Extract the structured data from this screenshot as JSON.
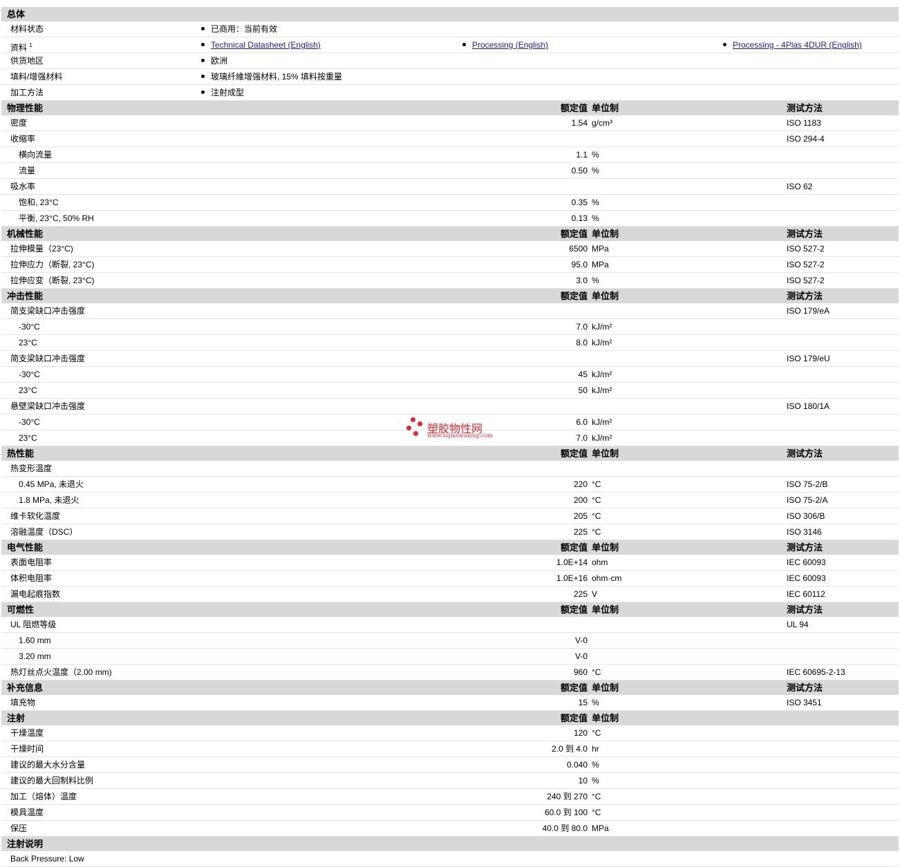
{
  "general": {
    "title": "总体",
    "rows": [
      {
        "label": "材料状态",
        "items": [
          "已商用：当前有效"
        ]
      },
      {
        "label": "资料",
        "sup": "1",
        "links": [
          "Technical Datasheet (English)",
          "Processing (English)",
          "Processing - 4Plas 4DUR (English)"
        ]
      },
      {
        "label": "供货地区",
        "items": [
          "欧洲"
        ]
      },
      {
        "label": "填料/增强材料",
        "items": [
          "玻璃纤維增强材料, 15% 填料按重量"
        ]
      },
      {
        "label": "加工方法",
        "items": [
          "注射成型"
        ]
      }
    ]
  },
  "headers": {
    "nominal": "额定值",
    "unit": "单位制",
    "test": "测试方法"
  },
  "sections": [
    {
      "title": "物理性能",
      "test_header": true,
      "rows": [
        {
          "label": "密度",
          "value": "1.54",
          "unit": "g/cm³",
          "test": "ISO 1183"
        },
        {
          "label": "收缩率",
          "value": "",
          "unit": "",
          "test": "ISO 294-4"
        },
        {
          "label": "横向流量",
          "sub": true,
          "value": "1.1",
          "unit": "%",
          "test": ""
        },
        {
          "label": "流量",
          "sub": true,
          "value": "0.50",
          "unit": "%",
          "test": ""
        },
        {
          "label": "吸水率",
          "value": "",
          "unit": "",
          "test": "ISO 62"
        },
        {
          "label": "饱和, 23°C",
          "sub": true,
          "value": "0.35",
          "unit": "%",
          "test": ""
        },
        {
          "label": "平衡, 23°C, 50% RH",
          "sub": true,
          "value": "0.13",
          "unit": "%",
          "test": ""
        }
      ]
    },
    {
      "title": "机械性能",
      "test_header": true,
      "rows": [
        {
          "label": "拉伸模量（23°C)",
          "value": "6500",
          "unit": "MPa",
          "test": "ISO 527-2"
        },
        {
          "label": "拉伸应力（断裂, 23°C)",
          "value": "95.0",
          "unit": "MPa",
          "test": "ISO 527-2"
        },
        {
          "label": "拉伸应变（断裂, 23°C)",
          "value": "3.0",
          "unit": "%",
          "test": "ISO 527-2"
        }
      ]
    },
    {
      "title": "冲击性能",
      "test_header": true,
      "rows": [
        {
          "label": "简支梁缺口冲击强度",
          "value": "",
          "unit": "",
          "test": "ISO 179/eA"
        },
        {
          "label": "-30°C",
          "sub": true,
          "value": "7.0",
          "unit": "kJ/m²",
          "test": ""
        },
        {
          "label": "23°C",
          "sub": true,
          "value": "8.0",
          "unit": "kJ/m²",
          "test": ""
        },
        {
          "label": "简支梁缺口冲击强度",
          "value": "",
          "unit": "",
          "test": "ISO 179/eU"
        },
        {
          "label": "-30°C",
          "sub": true,
          "value": "45",
          "unit": "kJ/m²",
          "test": ""
        },
        {
          "label": "23°C",
          "sub": true,
          "value": "50",
          "unit": "kJ/m²",
          "test": ""
        },
        {
          "label": "悬壁梁缺口冲击强度",
          "value": "",
          "unit": "",
          "test": "ISO 180/1A"
        },
        {
          "label": "-30°C",
          "sub": true,
          "value": "6.0",
          "unit": "kJ/m²",
          "test": ""
        },
        {
          "label": "23°C",
          "sub": true,
          "value": "7.0",
          "unit": "kJ/m²",
          "test": ""
        }
      ]
    },
    {
      "title": "热性能",
      "test_header": true,
      "rows": [
        {
          "label": "热变形温度",
          "value": "",
          "unit": "",
          "test": ""
        },
        {
          "label": "0.45 MPa, 未退火",
          "sub": true,
          "value": "220",
          "unit": "°C",
          "test": "ISO 75-2/B"
        },
        {
          "label": "1.8 MPa, 未退火",
          "sub": true,
          "value": "200",
          "unit": "°C",
          "test": "ISO 75-2/A"
        },
        {
          "label": "维卡软化温度",
          "value": "205",
          "unit": "°C",
          "test": "ISO 306/B"
        },
        {
          "label": "溶融温度（DSC）",
          "value": "225",
          "unit": "°C",
          "test": "ISO 3146"
        }
      ]
    },
    {
      "title": "电气性能",
      "test_header": true,
      "rows": [
        {
          "label": "表面电阻率",
          "value": "1.0E+14",
          "unit": "ohm",
          "test": "IEC 60093"
        },
        {
          "label": "体积电阻率",
          "value": "1.0E+16",
          "unit": "ohm·cm",
          "test": "IEC 60093"
        },
        {
          "label": "漏电起痕指数",
          "value": "225",
          "unit": "V",
          "test": "IEC 60112"
        }
      ]
    },
    {
      "title": "可燃性",
      "test_header": true,
      "rows": [
        {
          "label": "UL 阻燃等级",
          "value": "",
          "unit": "",
          "test": "UL 94"
        },
        {
          "label": "1.60 mm",
          "sub": true,
          "value": "V-0",
          "unit": "",
          "test": ""
        },
        {
          "label": "3.20 mm",
          "sub": true,
          "value": "V-0",
          "unit": "",
          "test": ""
        },
        {
          "label": "热灯丝点火温度（2.00 mm)",
          "value": "960",
          "unit": "°C",
          "test": "IEC 60695-2-13"
        }
      ]
    },
    {
      "title": "补充信息",
      "test_header": true,
      "rows": [
        {
          "label": "填充物",
          "value": "15",
          "unit": "%",
          "test": "ISO 3451"
        }
      ]
    },
    {
      "title": "注射",
      "test_header": false,
      "rows": [
        {
          "label": "干燥温度",
          "value": "120",
          "unit": "°C",
          "test": ""
        },
        {
          "label": "干燥时间",
          "value": "2.0 到  4.0",
          "unit": "hr",
          "test": ""
        },
        {
          "label": "建议的最大水分含量",
          "value": "0.040",
          "unit": "%",
          "test": ""
        },
        {
          "label": "建议的最大回制料比例",
          "value": "10",
          "unit": "%",
          "test": ""
        },
        {
          "label": "加工（熔体）温度",
          "value": "240 到  270",
          "unit": "°C",
          "test": ""
        },
        {
          "label": "模具温度",
          "value": "60.0 到  100",
          "unit": "°C",
          "test": ""
        },
        {
          "label": "保压",
          "value": "40.0 到  80.0",
          "unit": "MPa",
          "test": ""
        }
      ]
    }
  ],
  "notes": {
    "title": "注射说明",
    "text": "Back Pressure: Low"
  },
  "watermark": {
    "text": "塑胶物性网",
    "url": "www.sujiaowuxing.com",
    "color": "#e0282e"
  }
}
